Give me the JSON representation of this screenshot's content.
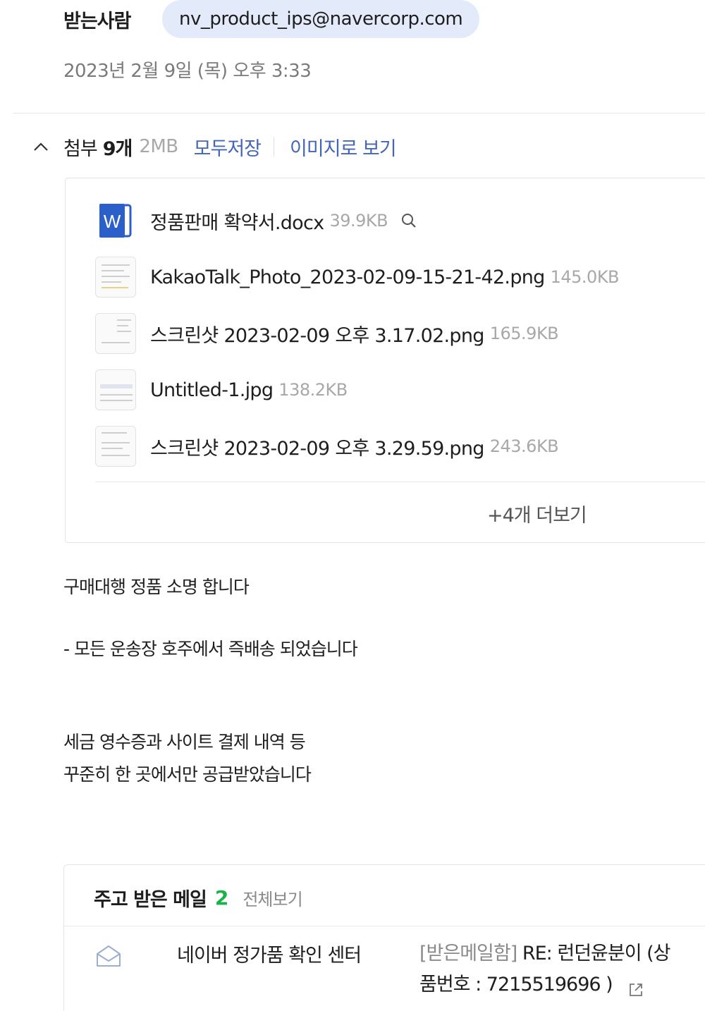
{
  "header": {
    "recipient_label": "받는사람",
    "recipient_email": "nv_product_ips@navercorp.com",
    "date": "2023년 2월 9일 (목) 오후 3:33"
  },
  "attachments": {
    "label": "첨부",
    "count": "9개",
    "total_size": "2MB",
    "save_all": "모두저장",
    "view_as_image": "이미지로 보기",
    "files": [
      {
        "name": "정품판매 확약서.docx",
        "size": "39.9KB",
        "icon": "word-doc-icon"
      },
      {
        "name": "KakaoTalk_Photo_2023-02-09-15-21-42.png",
        "size": "145.0KB",
        "icon": "image-thumbnail"
      },
      {
        "name": "스크린샷 2023-02-09 오후 3.17.02.png",
        "size": "165.9KB",
        "icon": "image-thumbnail"
      },
      {
        "name": "Untitled-1.jpg",
        "size": "138.2KB",
        "icon": "image-thumbnail"
      },
      {
        "name": "스크린샷 2023-02-09 오후 3.29.59.png",
        "size": "243.6KB",
        "icon": "image-thumbnail"
      }
    ],
    "more": "+4개 더보기"
  },
  "body": {
    "line1": "구매대행 정품 소명 합니다",
    "line2": "- 모든 운송장 호주에서 즉배송 되었습니다",
    "line3": "세금 영수증과 사이트 결제 내역 등",
    "line4": "꾸준히 한 곳에서만 공급받았습니다"
  },
  "thread": {
    "title": "주고 받은 메일",
    "count": "2",
    "view_all": "전체보기",
    "item": {
      "icon": "envelope-open-icon",
      "sender": "네이버 정가품 확인 센터",
      "folder": "[받은메일함]",
      "subject_line1": " RE: 런던윤분이 (상",
      "subject_line2": "품번호 : 7215519696 )"
    }
  },
  "colors": {
    "chip_bg": "#e3ebfa",
    "link": "#4466b8",
    "count_green": "#19b34a",
    "word_blue": "#2b5fc9",
    "muted": "#a8a8a8"
  }
}
